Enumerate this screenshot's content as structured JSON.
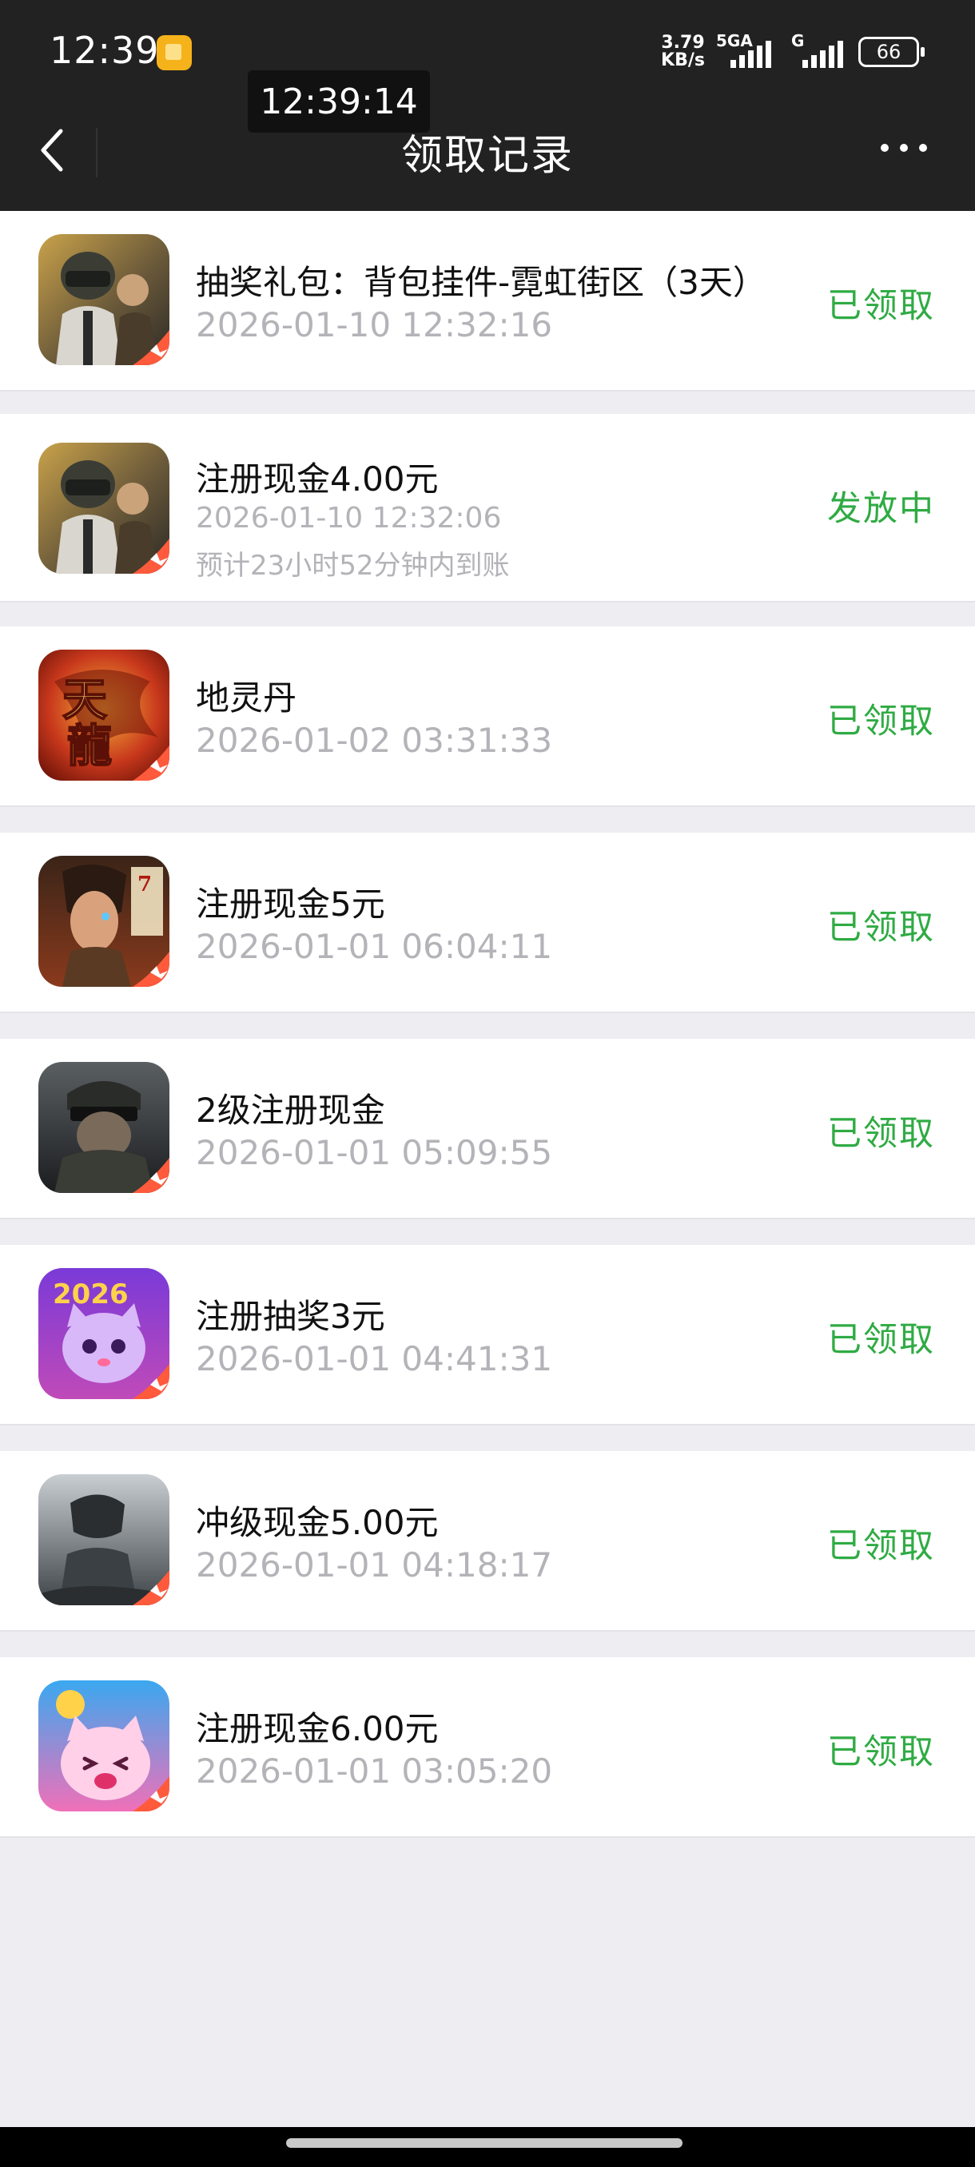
{
  "status_bar": {
    "time": "12:39",
    "net_speed_value": "3.79",
    "net_speed_unit": "KB/s",
    "network_label_1": "5GA",
    "network_label_2": "G",
    "battery": "66"
  },
  "floating_clock": "12:39:14",
  "nav": {
    "title": "领取记录",
    "back_icon": "chevron-left-icon",
    "more_icon": "more-dots-icon"
  },
  "colors": {
    "status_green": "#2fab43",
    "timestamp_gray": "#b3b3b8",
    "page_bg": "#ededf2",
    "nav_bg": "#222222"
  },
  "records": [
    {
      "title": "抽奖礼包：背包挂件-霓虹街区（3天）",
      "time": "2026-01-10 12:32:16",
      "status": "已领取",
      "icon": "pubg-game-icon"
    },
    {
      "title": "注册现金4.00元",
      "time": "2026-01-10 12:32:06",
      "note": "预计23小时52分钟内到账",
      "status": "发放中",
      "icon": "pubg-game-icon"
    },
    {
      "title": "地灵丹",
      "time": "2026-01-02 03:31:33",
      "status": "已领取",
      "icon": "tianlong-game-icon"
    },
    {
      "title": "注册现金5元",
      "time": "2026-01-01 06:04:11",
      "status": "已领取",
      "icon": "warrior-game-icon"
    },
    {
      "title": "2级注册现金",
      "time": "2026-01-01 05:09:55",
      "status": "已领取",
      "icon": "soldier-game-icon"
    },
    {
      "title": "注册抽奖3元",
      "time": "2026-01-01 04:41:31",
      "status": "已领取",
      "icon": "cat-2026-game-icon"
    },
    {
      "title": "冲级现金5.00元",
      "time": "2026-01-01 04:18:17",
      "status": "已领取",
      "icon": "shooter-game-icon"
    },
    {
      "title": "注册现金6.00元",
      "time": "2026-01-01 03:05:20",
      "status": "已领取",
      "icon": "cartoon-cat-game-icon"
    }
  ]
}
